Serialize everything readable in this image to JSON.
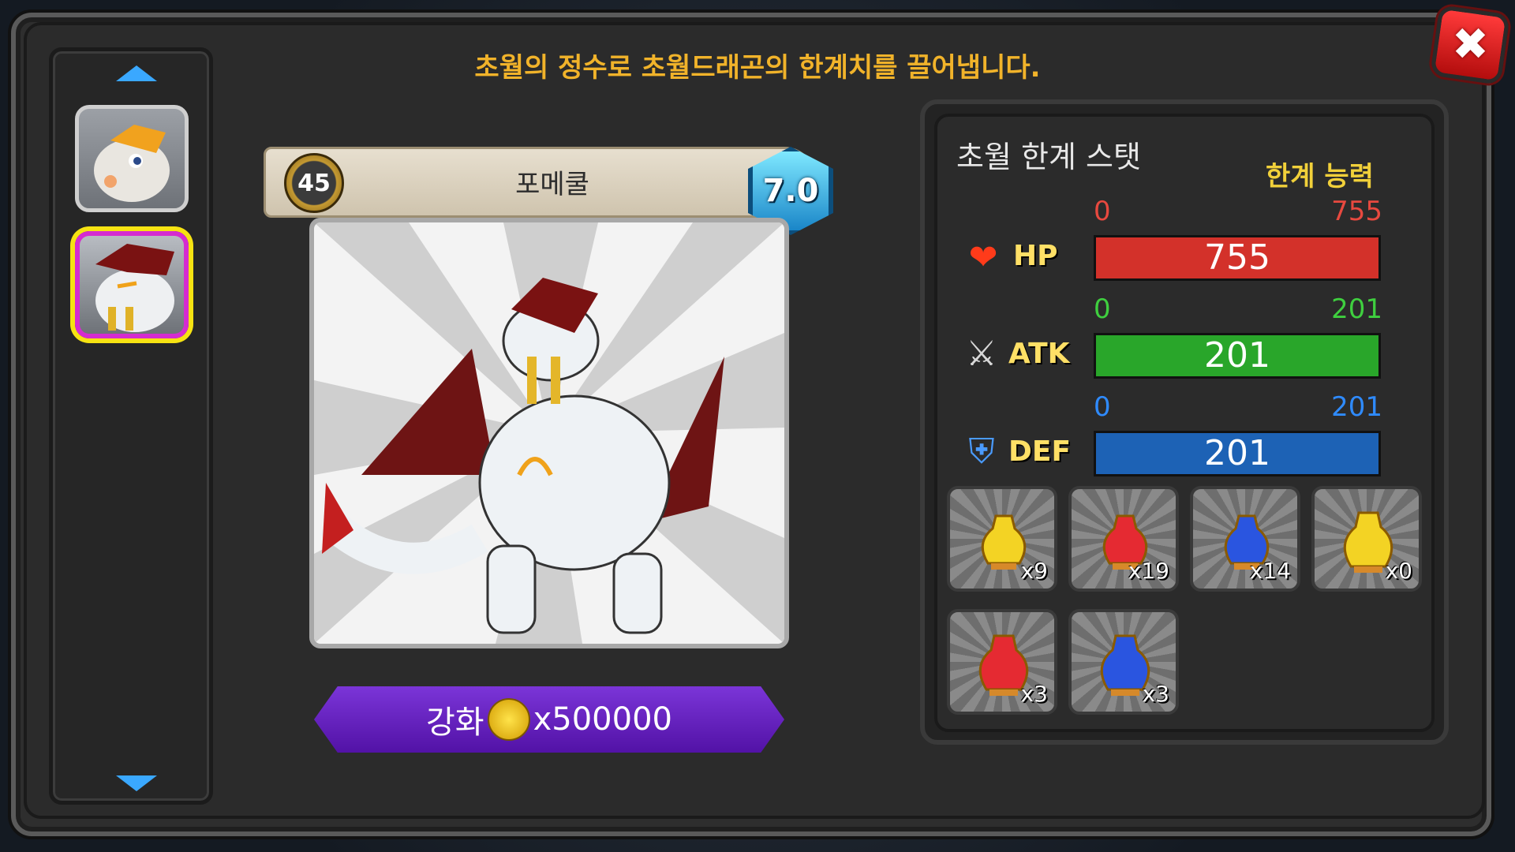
{
  "header": {
    "message": "초월의 정수로 초월드래곤의 한계치를 끌어냅니다."
  },
  "close_button": {
    "label": "✖"
  },
  "dragon": {
    "level": "45",
    "name": "포메쿨",
    "grade": "7.0"
  },
  "upgrade": {
    "label": "강화",
    "cost": "x500000"
  },
  "stats": {
    "title": "초월 한계 스탯",
    "limit_label": "한계 능력",
    "hp": {
      "name": "HP",
      "min": "0",
      "max": "755",
      "value": "755",
      "fraction": 1.0,
      "color": "#d3312a",
      "label_color": "#e8493f"
    },
    "atk": {
      "name": "ATK",
      "min": "0",
      "max": "201",
      "value": "201",
      "fraction": 1.0,
      "color": "#29a62a",
      "label_color": "#3fcf3f"
    },
    "def": {
      "name": "DEF",
      "min": "0",
      "max": "201",
      "value": "201",
      "fraction": 1.0,
      "color": "#1d62b5",
      "label_color": "#2f8bff"
    }
  },
  "potions": [
    {
      "color": "yellow",
      "count": "x9"
    },
    {
      "color": "red",
      "count": "x19"
    },
    {
      "color": "blue",
      "count": "x14"
    },
    {
      "color": "yellow",
      "count": "x0"
    },
    {
      "color": "red",
      "count": "x3"
    },
    {
      "color": "blue",
      "count": "x3"
    }
  ],
  "icons": {
    "hp": "heart-icon",
    "atk": "crossed-swords-icon",
    "def": "shield-icon",
    "coin": "coin-icon"
  }
}
